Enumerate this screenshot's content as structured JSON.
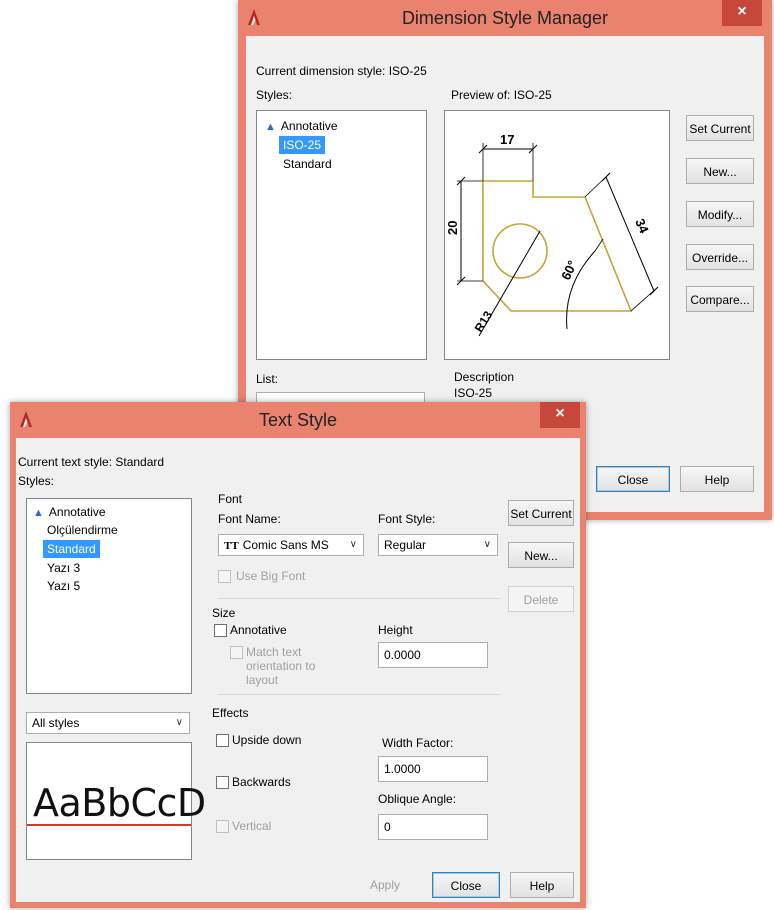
{
  "dsm": {
    "title": "Dimension Style Manager",
    "close_glyph": "×",
    "current_label": "Current dimension style: ISO-25",
    "styles_label": "Styles:",
    "styles": [
      {
        "label": "Annotative",
        "annotative": true,
        "selected": false
      },
      {
        "label": "ISO-25",
        "annotative": false,
        "selected": true
      },
      {
        "label": "Standard",
        "annotative": false,
        "selected": false
      }
    ],
    "preview_label": "Preview of: ISO-25",
    "preview_dims": {
      "d17": "17",
      "d20": "20",
      "d34": "34",
      "angle": "60°",
      "radius": "R13"
    },
    "list_label": "List:",
    "description_label": "Description",
    "description_value": "ISO-25",
    "buttons": {
      "set_current": "Set Current",
      "new": "New...",
      "modify": "Modify...",
      "override": "Override...",
      "compare": "Compare...",
      "close": "Close",
      "help": "Help"
    },
    "accent_color": "#e9836f"
  },
  "ts": {
    "title": "Text Style",
    "close_glyph": "×",
    "current_label": "Current text style:  Standard",
    "styles_label": "Styles:",
    "styles": [
      {
        "label": "Annotative",
        "annotative": true,
        "selected": false
      },
      {
        "label": "Olçülendirme",
        "annotative": false,
        "selected": false
      },
      {
        "label": "Standard",
        "annotative": false,
        "selected": true
      },
      {
        "label": "Yazı 3",
        "annotative": false,
        "selected": false
      },
      {
        "label": "Yazı 5",
        "annotative": false,
        "selected": false
      }
    ],
    "filter_value": "All styles",
    "preview_text": "AaBbCcD",
    "font_group": "Font",
    "font_name_label": "Font Name:",
    "font_name_value": "Comic Sans MS",
    "font_icon": "TT",
    "font_style_label": "Font Style:",
    "font_style_value": "Regular",
    "use_big_font_label": "Use Big Font",
    "size_group": "Size",
    "annotative_label": "Annotative",
    "match_orientation_label": "Match text orientation to layout",
    "height_label": "Height",
    "height_value": "0.0000",
    "effects_group": "Effects",
    "upside_down_label": "Upside down",
    "backwards_label": "Backwards",
    "vertical_label": "Vertical",
    "width_factor_label": "Width Factor:",
    "width_factor_value": "1.0000",
    "oblique_label": "Oblique Angle:",
    "oblique_value": "0",
    "buttons": {
      "set_current": "Set Current",
      "new": "New...",
      "delete": "Delete",
      "apply": "Apply",
      "close": "Close",
      "help": "Help"
    }
  }
}
